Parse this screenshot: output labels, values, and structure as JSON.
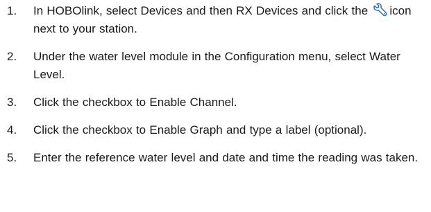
{
  "steps": [
    {
      "number": "1.",
      "text_before_icon": "In HOBOlink, select Devices and then RX Devices and click the ",
      "icon": "wrench-icon",
      "text_after_icon": "icon next to your station."
    },
    {
      "number": "2.",
      "text": "Under the water level module in the Configuration menu, select Water Level."
    },
    {
      "number": "3.",
      "text": "Click the checkbox to Enable Channel."
    },
    {
      "number": "4.",
      "text": "Click the checkbox to Enable Graph and type a label (optional)."
    },
    {
      "number": "5.",
      "text": "Enter the reference water level and date and time the reading was taken."
    }
  ],
  "colors": {
    "text": "#1a1a1a",
    "icon_stroke": "#2e6fb8"
  }
}
